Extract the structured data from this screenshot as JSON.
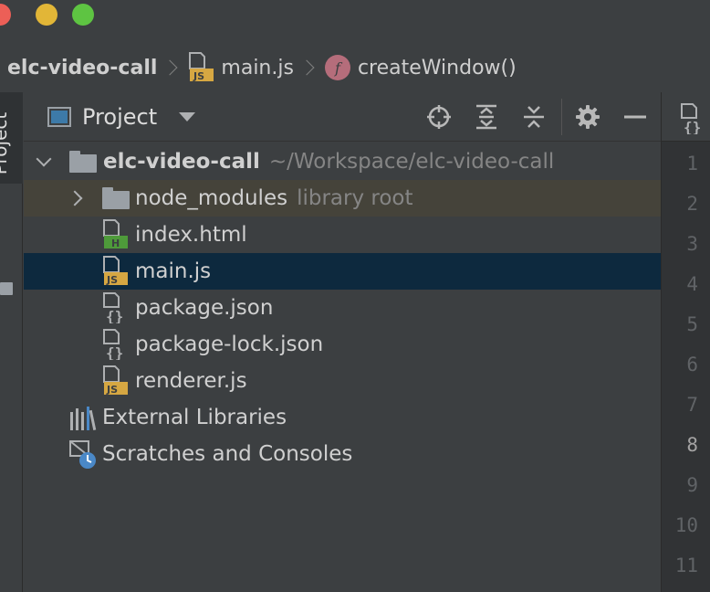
{
  "breadcrumb": {
    "project": "elc-video-call",
    "file": "main.js",
    "function_badge": "f",
    "function": "createWindow()"
  },
  "toolstrip": {
    "project_tab": "Project"
  },
  "panel": {
    "title": "Project",
    "tools": [
      "locate-icon",
      "expand-all-icon",
      "collapse-all-icon",
      "gear-icon",
      "minimize-icon"
    ]
  },
  "tree": {
    "root": {
      "name": "elc-video-call",
      "path": "~/Workspace/elc-video-call"
    },
    "node_modules": {
      "name": "node_modules",
      "hint": "library root"
    },
    "files": [
      {
        "name": "index.html",
        "type": "html",
        "badge": "H"
      },
      {
        "name": "main.js",
        "type": "js",
        "badge": "JS"
      },
      {
        "name": "package.json",
        "type": "json",
        "badge": "{}"
      },
      {
        "name": "package-lock.json",
        "type": "json",
        "badge": "{}"
      },
      {
        "name": "renderer.js",
        "type": "js",
        "badge": "JS"
      }
    ],
    "external_libraries": "External Libraries",
    "scratches": "Scratches and Consoles"
  },
  "editor": {
    "line_numbers": [
      "1",
      "2",
      "3",
      "4",
      "5",
      "6",
      "7",
      "8",
      "9",
      "10",
      "11"
    ],
    "current_line": "8"
  },
  "colors": {
    "background": "#3c3f41",
    "selection": "#0d293e",
    "library_row": "#45433a",
    "js_badge": "#d6a742",
    "html_badge": "#4e9a3a"
  }
}
